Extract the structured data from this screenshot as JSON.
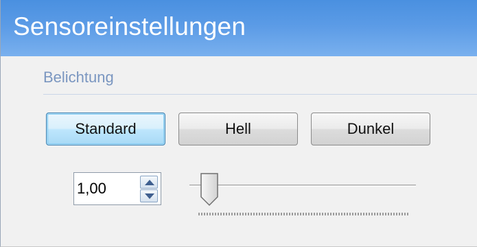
{
  "window": {
    "title": "Sensoreinstellungen"
  },
  "exposure_group": {
    "label": "Belichtung",
    "buttons": {
      "standard": "Standard",
      "bright": "Hell",
      "dark": "Dunkel"
    },
    "value": "1,00",
    "slider": {
      "level": 0.05
    }
  },
  "icons": {
    "spin_up": "arrow-up-icon",
    "spin_down": "arrow-down-icon"
  },
  "colors": {
    "title_bar": "#5b9be6",
    "group_label": "#7a96c0",
    "default_button_border": "#3c7fb1"
  }
}
